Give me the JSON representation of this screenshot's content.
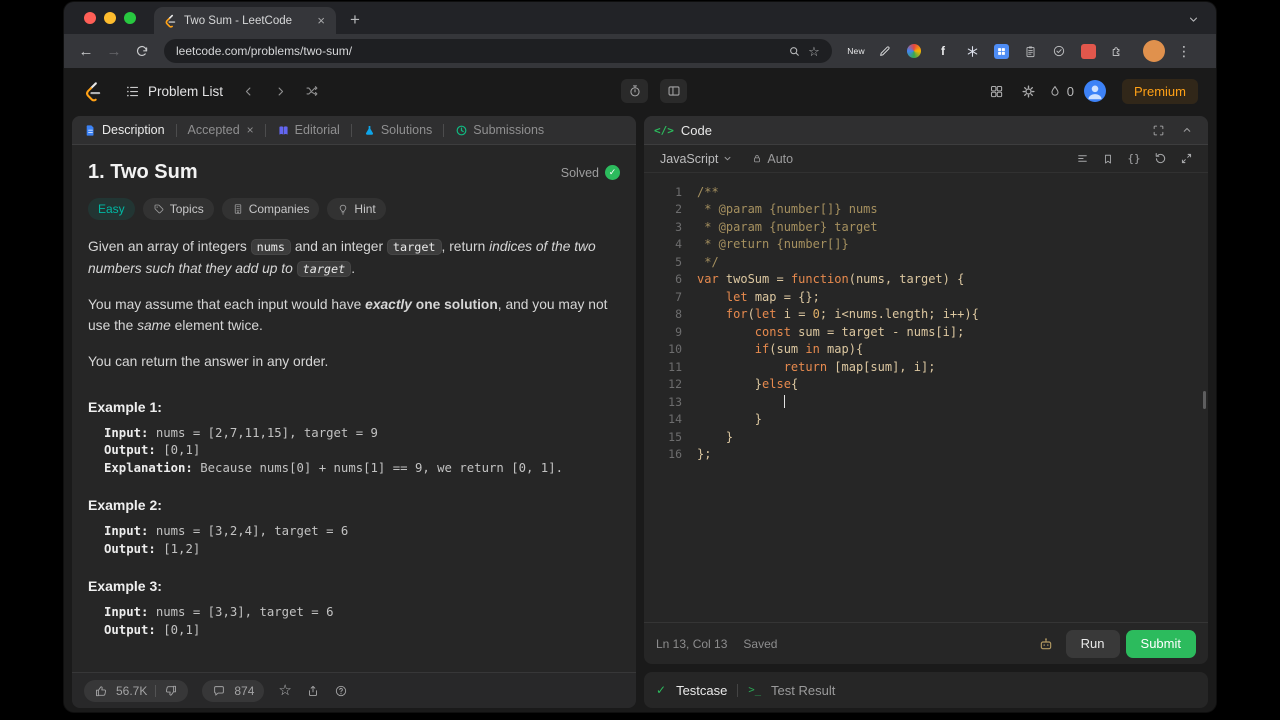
{
  "theme": {
    "accent_green": "#2cbb5d",
    "premium_orange": "#ffa116",
    "easy_teal": "#00b8a3",
    "traffic_red": "#ff5f57",
    "traffic_yellow": "#febc2e",
    "traffic_green": "#28c840"
  },
  "icons": {
    "close": "×",
    "plus": "+",
    "back": "←",
    "forward": "→",
    "kebab": "⋮",
    "star": "☆",
    "check": "✓",
    "braces": "{}",
    "code_tag": "</>",
    "terminal_prompt": ">_",
    "f_ext": "f"
  },
  "browser": {
    "tab_title": "Two Sum - LeetCode",
    "url": "leetcode.com/problems/two-sum/",
    "new_badge": "New"
  },
  "nav": {
    "problem_list": "Problem List",
    "streak_count": "0",
    "premium": "Premium"
  },
  "panel_tabs": [
    {
      "label": "Description"
    },
    {
      "label": "Accepted"
    },
    {
      "label": "Editorial"
    },
    {
      "label": "Solutions"
    },
    {
      "label": "Submissions"
    }
  ],
  "problem": {
    "title": "1. Two Sum",
    "solved_label": "Solved",
    "difficulty": "Easy",
    "meta": [
      "Topics",
      "Companies",
      "Hint"
    ],
    "paragraphs": [
      {
        "runs": [
          {
            "t": "Given an array of integers "
          },
          {
            "t": "nums",
            "c": 1
          },
          {
            "t": " and an integer "
          },
          {
            "t": "target",
            "c": 1
          },
          {
            "t": ", return "
          },
          {
            "t": "indices of the two numbers such that they add up to ",
            "i": 1
          },
          {
            "t": "target",
            "c": 1,
            "i": 1
          },
          {
            "t": "."
          }
        ]
      },
      {
        "runs": [
          {
            "t": "You may assume that each input would have "
          },
          {
            "t": "exactly",
            "b": 1,
            "i": 1
          },
          {
            "t": " one solution",
            "b": 1
          },
          {
            "t": ", and you may not use the "
          },
          {
            "t": "same",
            "i": 1
          },
          {
            "t": " element twice."
          }
        ]
      },
      {
        "runs": [
          {
            "t": "You can return the answer in any order."
          }
        ]
      }
    ],
    "examples": [
      {
        "label": "Example 1:",
        "lines": [
          {
            "label": "Input:",
            "text": " nums = [2,7,11,15], target = 9"
          },
          {
            "label": "Output:",
            "text": " [0,1]"
          },
          {
            "label": "Explanation:",
            "text": " Because nums[0] + nums[1] == 9, we return [0, 1]."
          }
        ]
      },
      {
        "label": "Example 2:",
        "lines": [
          {
            "label": "Input:",
            "text": " nums = [3,2,4], target = 6"
          },
          {
            "label": "Output:",
            "text": " [1,2]"
          }
        ]
      },
      {
        "label": "Example 3:",
        "lines": [
          {
            "label": "Input:",
            "text": " nums = [3,3], target = 6"
          },
          {
            "label": "Output:",
            "text": " [0,1]"
          }
        ]
      }
    ]
  },
  "footer": {
    "likes": "56.7K",
    "comments": "874"
  },
  "editor": {
    "panel_title": "Code",
    "language": "JavaScript",
    "auto_label": "Auto",
    "code_lines": [
      "/**",
      " * @param {number[]} nums",
      " * @param {number} target",
      " * @return {number[]}",
      " */",
      "var twoSum = function(nums, target) {",
      "    let map = {};",
      "    for(let i = 0; i<nums.length; i++){",
      "        const sum = target - nums[i];",
      "        if(sum in map){",
      "            return [map[sum], i];",
      "        }else{",
      "            ",
      "        }",
      "    }",
      "};"
    ],
    "cursor": {
      "line": 13,
      "col": 13
    },
    "status_position": "Ln 13, Col 13",
    "status_saved": "Saved",
    "run_label": "Run",
    "submit_label": "Submit"
  },
  "console": {
    "testcase_label": "Testcase",
    "test_result_label": "Test Result"
  }
}
